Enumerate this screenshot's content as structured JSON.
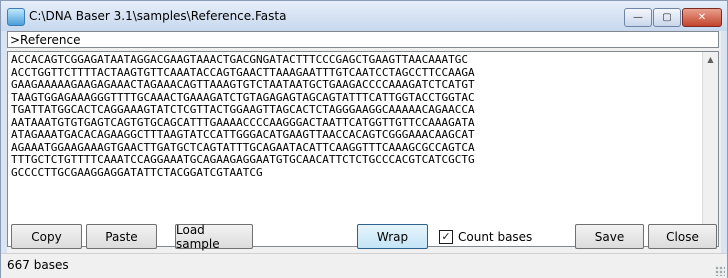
{
  "window": {
    "title": "C:\\DNA Baser 3.1\\samples\\Reference.Fasta",
    "minimize_glyph": "—",
    "maximize_glyph": "▢",
    "close_glyph": "✕"
  },
  "header": {
    "value": ">Reference"
  },
  "sequence": {
    "lines": [
      "ACCACAGTCGGAGATAATAGGACGAAGTAAACTGACGNGATACTTTCCCGAGCTGAAGTTAACAAATGC",
      "ACCTGGTTCTTTTACTAAGTGTTCAAATACCAGTGAACTTAAAGAATTTGTCAATCCTAGCCTTCCAAGA",
      "GAAGAAAAAGAAGAGAAACTAGAAACAGTTAAAGTGTCTAATAATGCTGAAGACCCCAAAGATCTCATGT",
      "TAAGTGGAGAAAGGGTTTTGCAAACTGAAAGATCTGTAGAGAGTAGCAGTATTTCATTGGTACCTGGTAC",
      "TGATTATGGCACTCAGGAAAGTATCTCGTTACTGGAAGTTAGCACTCTAGGGAAGGCAAAAACAGAACCA",
      "AATAAATGTGTGAGTCAGTGTGCAGCATTTGAAAACCCCAAGGGACTAATTCATGGTTGTTCCAAAGATA",
      "ATAGAAATGACACAGAAGGCTTTAAGTATCCATTGGGACATGAAGTTAACCACAGTCGGGAAACAAGCAT",
      "AGAAATGGAAGAAAGTGAACTTGATGCTCAGTATTTGCAGAATACATTCAAGGTTTCAAAGCGCCAGTCA",
      "TTTGCTCTGTTTTCAAATCCAGGAAATGCAGAAGAGGAATGTGCAACATTCTCTGCCCACGTCATCGCTG",
      "GCCCCTTGCGAAGGAGGATATTCTACGGATCGTAATCG"
    ]
  },
  "toolbar": {
    "copy": "Copy",
    "paste": "Paste",
    "load_sample": "Load sample",
    "wrap": "Wrap",
    "count_bases": "Count bases",
    "count_bases_checked": true,
    "save": "Save",
    "close": "Close"
  },
  "status": {
    "text": "667 bases"
  }
}
